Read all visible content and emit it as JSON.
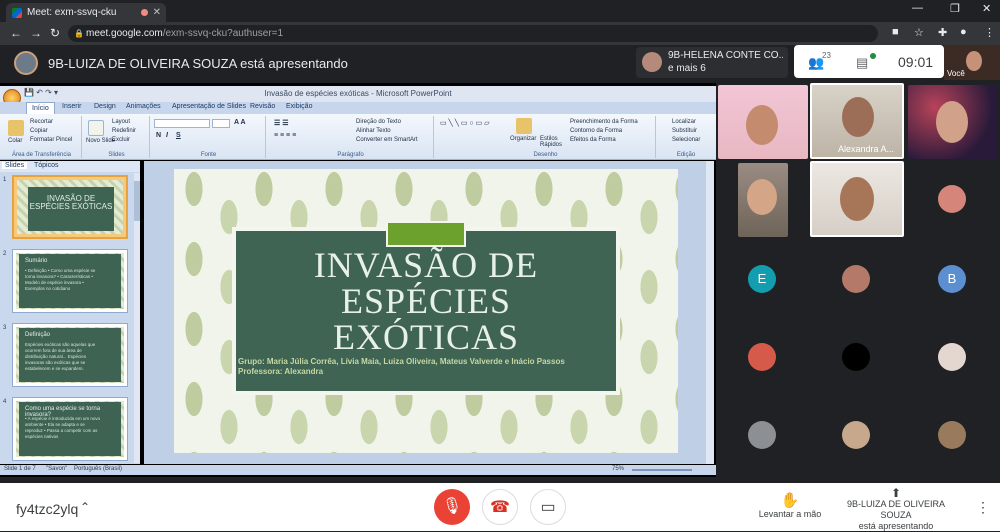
{
  "browser": {
    "tab_title": "Meet: exm-ssvq-cku",
    "url_host": "meet.google.com",
    "url_path": "/exm-ssvq-cku?authuser=1"
  },
  "meet": {
    "presenter_banner": "9B-LUIZA DE OLIVEIRA SOUZA está apresentando",
    "tile_strip_name": "9B-HELENA CONTE CO...",
    "tile_strip_more": "e mais 6",
    "participants_count": "23",
    "clock": "09:01",
    "self_label": "Você",
    "meeting_code": "fy4tzc2ylq",
    "raise_hand_label": "Levantar a mão",
    "presenting_name": "9B-LUIZA DE OLIVEIRA SOUZA",
    "presenting_label": "está apresentando",
    "grid_named_tile": "Alexandra A...",
    "letters": [
      "E",
      "B"
    ]
  },
  "ppt": {
    "window_title": "Invasão de espécies exóticas - Microsoft PowerPoint",
    "tabs": [
      "Início",
      "Inserir",
      "Design",
      "Animações",
      "Apresentação de Slides",
      "Revisão",
      "Exibição"
    ],
    "clipboard": {
      "paste": "Colar",
      "cut": "Recortar",
      "copy": "Copiar",
      "format_painter": "Formatar Pincel",
      "label": "Área de Transferência"
    },
    "slides_group": {
      "new": "Novo Slide",
      "layout": "Layout",
      "reset": "Redefinir",
      "delete": "Excluir",
      "label": "Slides"
    },
    "font_label": "Fonte",
    "paragraph": {
      "direction": "Direção do Texto",
      "align": "Alinhar Texto",
      "smartart": "Converter em SmartArt",
      "label": "Parágrafo"
    },
    "drawing": {
      "arrange": "Organizar",
      "quick_styles": "Estilos Rápidos",
      "fill": "Preenchimento da Forma",
      "outline": "Contorno da Forma",
      "effects": "Efeitos da Forma",
      "label": "Desenho"
    },
    "editing": {
      "find": "Localizar",
      "replace": "Substituir",
      "select": "Selecionar",
      "label": "Edição"
    },
    "pane_tabs": [
      "Slides",
      "Tópicos"
    ],
    "thumbs": [
      {
        "num": "1",
        "title": "INVASÃO DE ESPÉCIES EXÓTICAS"
      },
      {
        "num": "2",
        "title": "Sumário",
        "body": "• Definição • Como uma espécie se torna invasora? • Características • Modelo de espécie invasora • Exemplos no cotidiano"
      },
      {
        "num": "3",
        "title": "Definição",
        "body": "Espécies exóticas são aquelas que ocorrem fora de sua área de distribuição natural... Espécies invasoras são exóticas que se estabelecem e se expandem."
      },
      {
        "num": "4",
        "title": "Como uma espécie se torna invasora?",
        "body": "• A espécie é introduzida em um novo ambiente • Ela se adapta e se reproduz • Passa a competir com as espécies nativas"
      }
    ],
    "slide": {
      "title_line1": "INVASÃO DE",
      "title_line2": "ESPÉCIES",
      "title_line3": "EXÓTICAS",
      "group": "Grupo: Maria Júlia Corrêa, Lívia Maia, Luiza Oliveira, Mateus Valverde e Inácio Passos",
      "teacher": "Professora: Alexandra"
    },
    "status": {
      "slide": "Slide 1 de 7",
      "theme": "\"Savon\"",
      "lang": "Português (Brasil)",
      "zoom": "75%"
    }
  }
}
